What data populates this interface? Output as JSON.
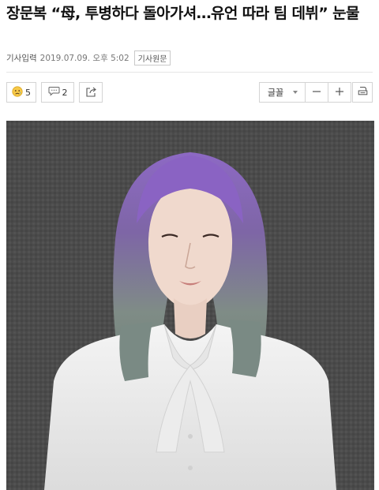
{
  "article": {
    "headline": "장문복 “母, 투병하다 돌아가셔…유언 따라 팀 데뷔” 눈물",
    "meta_label": "기사입력",
    "date": "2019.07.09. 오후 5:02",
    "source_button": "기사원문"
  },
  "toolbar": {
    "reaction_icon": "sad-face-icon",
    "reaction_count": "5",
    "comment_icon": "comment-bubble-icon",
    "comment_count": "2",
    "share_icon": "share-icon",
    "font_label": "글꼴",
    "font_dropdown_icon": "caret-down-icon",
    "decrease_icon": "minus-icon",
    "increase_icon": "plus-icon",
    "print_icon": "print-icon"
  },
  "colors": {
    "hair": "#7b5aa8",
    "background_photo": "#4a4a4a",
    "border": "#d4d4d4"
  }
}
